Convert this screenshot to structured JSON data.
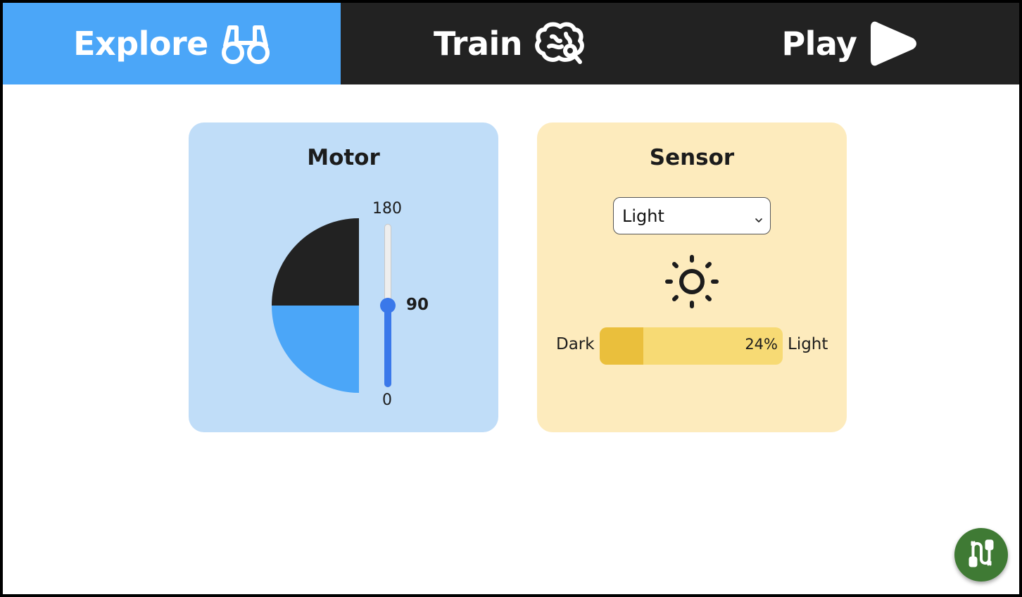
{
  "nav": {
    "tabs": [
      {
        "label": "Explore",
        "icon": "binoculars-icon",
        "active": true
      },
      {
        "label": "Train",
        "icon": "brain-icon",
        "active": false
      },
      {
        "label": "Play",
        "icon": "play-icon",
        "active": false
      }
    ]
  },
  "motor": {
    "title": "Motor",
    "slider": {
      "min": "0",
      "max": "180",
      "value": "90"
    }
  },
  "sensor": {
    "title": "Sensor",
    "select": {
      "selected": "Light"
    },
    "icon": "sun-icon",
    "bar": {
      "left_label": "Dark",
      "right_label": "Light",
      "percent_label": "24%",
      "percent": 24
    }
  },
  "fab": {
    "icon": "cable-connector-icon"
  },
  "colors": {
    "nav_bg": "#222222",
    "active_tab": "#4ba6f8",
    "motor_card": "#c0ddf8",
    "sensor_card": "#fdebbd",
    "slider_accent": "#3a78ea",
    "bar_fill": "#eabf3c",
    "bar_track": "#f7da74",
    "fab_bg": "#3f7a34"
  }
}
